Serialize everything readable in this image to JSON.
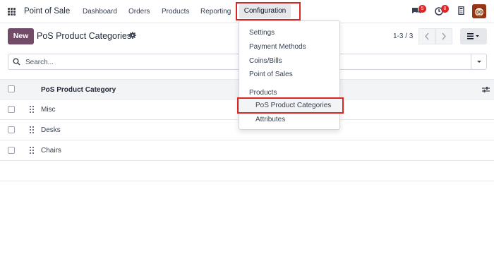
{
  "navbar": {
    "app_title": "Point of Sale",
    "menu": [
      "Dashboard",
      "Orders",
      "Products",
      "Reporting"
    ],
    "config_label": "Configuration",
    "messages_badge": "5",
    "activities_badge": "8"
  },
  "control": {
    "new_label": "New",
    "title": "PoS Product Categories",
    "pager": "1-3 / 3"
  },
  "search": {
    "placeholder": "Search..."
  },
  "list": {
    "column": "PoS Product Category",
    "rows": [
      "Misc",
      "Desks",
      "Chairs"
    ]
  },
  "dropdown": {
    "items": [
      "Settings",
      "Payment Methods",
      "Coins/Bills",
      "Point of Sales"
    ],
    "section": "Products",
    "sub_items": [
      "PoS Product Categories",
      "Attributes"
    ]
  },
  "colors": {
    "brand": "#714b67",
    "highlight": "#dc2626"
  }
}
